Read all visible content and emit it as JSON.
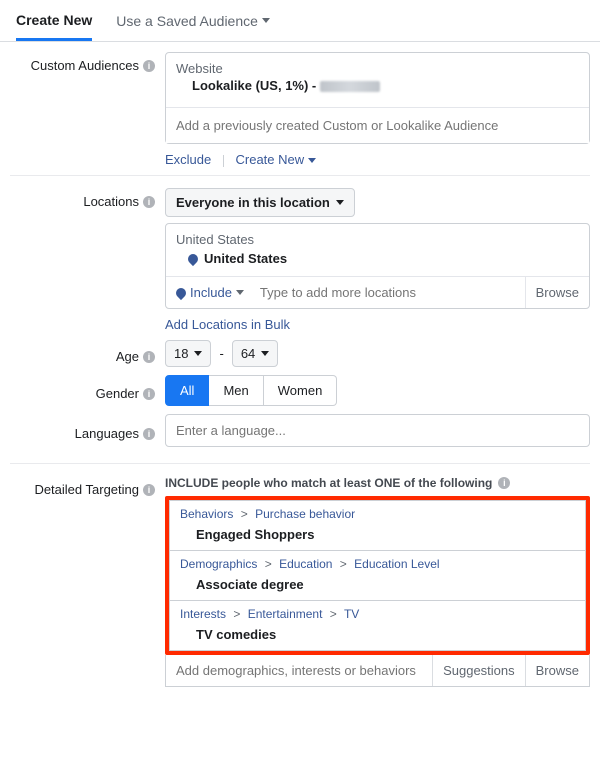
{
  "tabs": {
    "create_new": "Create New",
    "saved_audience": "Use a Saved Audience"
  },
  "custom_audiences": {
    "label": "Custom Audiences",
    "website_label": "Website",
    "lookalike_prefix": "Lookalike (US, 1%) - ",
    "add_placeholder": "Add a previously created Custom or Lookalike Audience",
    "exclude": "Exclude",
    "create_new": "Create New"
  },
  "locations": {
    "label": "Locations",
    "scope": "Everyone in this location",
    "region_header": "United States",
    "item": "United States",
    "include": "Include",
    "input_placeholder": "Type to add more locations",
    "browse": "Browse",
    "bulk_link": "Add Locations in Bulk"
  },
  "age": {
    "label": "Age",
    "min": "18",
    "sep": "-",
    "max": "64"
  },
  "gender": {
    "label": "Gender",
    "all": "All",
    "men": "Men",
    "women": "Women"
  },
  "languages": {
    "label": "Languages",
    "placeholder": "Enter a language..."
  },
  "detailed": {
    "label": "Detailed Targeting",
    "include_heading": "INCLUDE people who match at least ONE of the following",
    "items": [
      {
        "crumbs": [
          "Behaviors",
          "Purchase behavior"
        ],
        "value": "Engaged Shoppers"
      },
      {
        "crumbs": [
          "Demographics",
          "Education",
          "Education Level"
        ],
        "value": "Associate degree"
      },
      {
        "crumbs": [
          "Interests",
          "Entertainment",
          "TV"
        ],
        "value": "TV comedies"
      }
    ],
    "add_placeholder": "Add demographics, interests or behaviors",
    "suggestions": "Suggestions",
    "browse": "Browse"
  },
  "glyphs": {
    "info": "i",
    "gt": ">"
  }
}
